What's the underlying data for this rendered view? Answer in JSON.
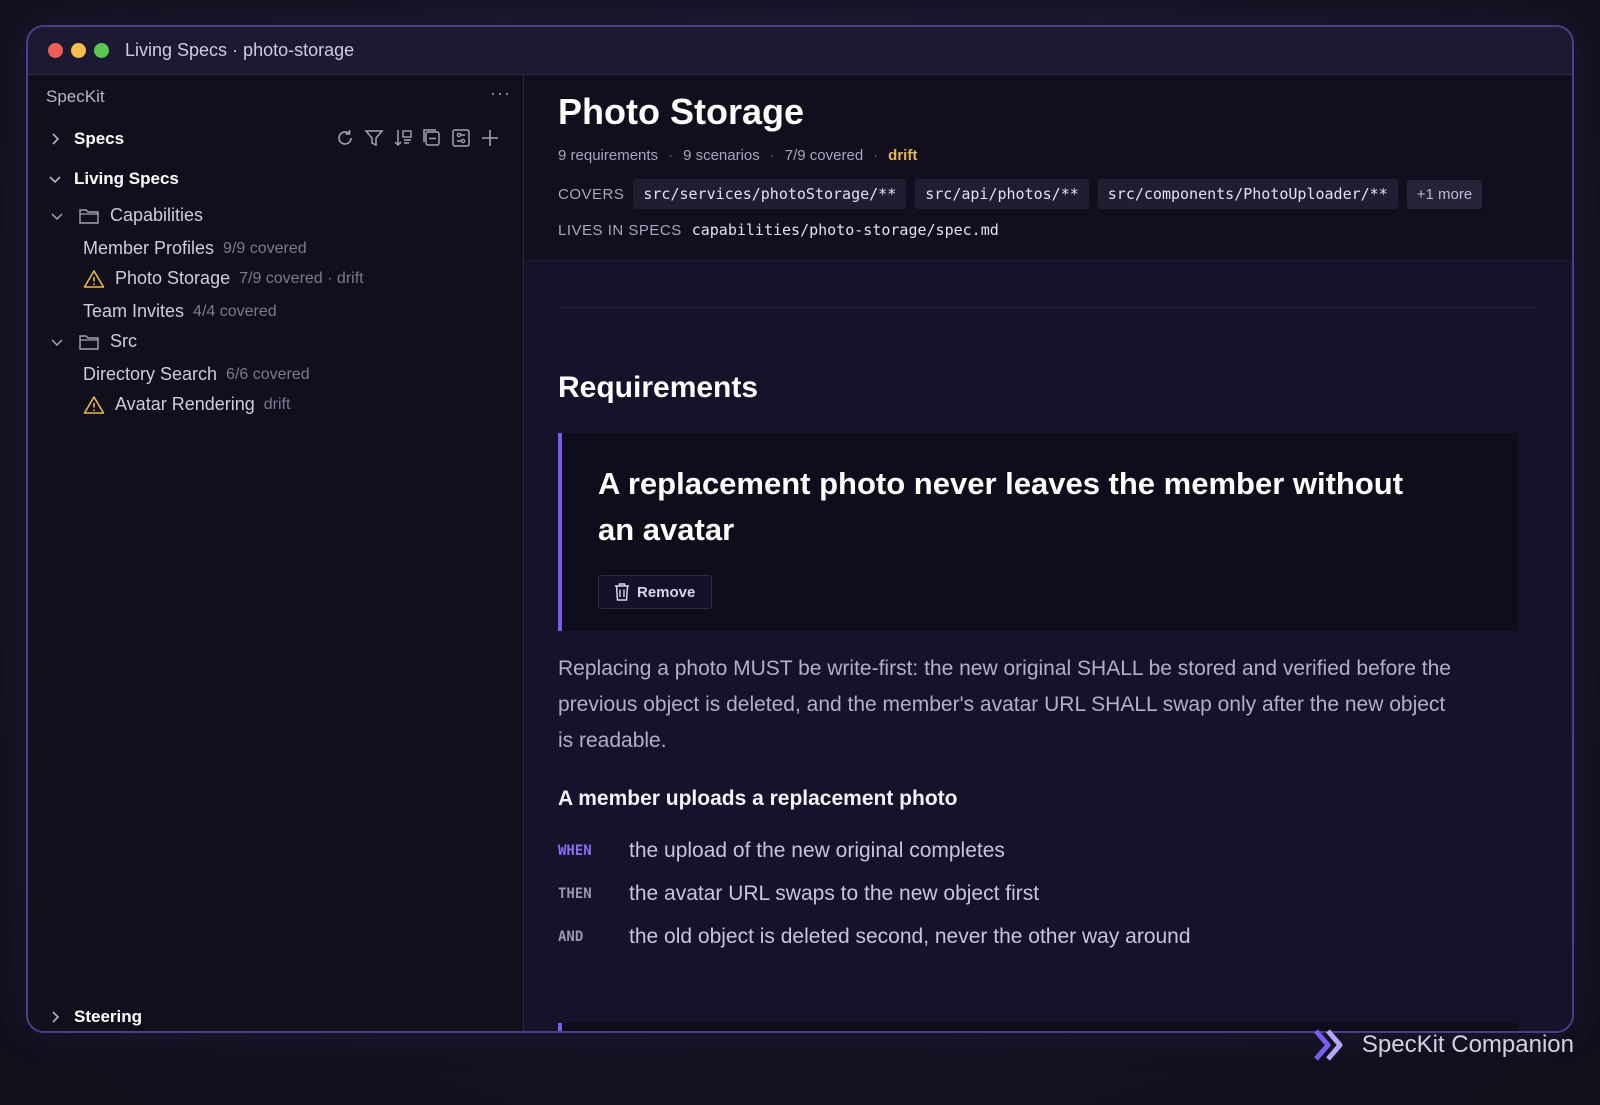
{
  "window": {
    "title": "Living Specs · photo-storage"
  },
  "sidebar": {
    "header": "SpecKit",
    "more": "···",
    "specs_label": "Specs",
    "living_specs_label": "Living Specs",
    "toolbar_icons": [
      "refresh-icon",
      "filter-icon",
      "sort-icon",
      "collapse-icon",
      "settings-icon",
      "plus-icon"
    ],
    "folders": [
      {
        "label": "Capabilities",
        "items": [
          {
            "label": "Member Profiles",
            "meta": "9/9 covered",
            "warning": false
          },
          {
            "label": "Photo Storage",
            "meta": "7/9 covered · drift",
            "warning": true
          },
          {
            "label": "Team Invites",
            "meta": "4/4 covered",
            "warning": false
          }
        ]
      },
      {
        "label": "Src",
        "items": [
          {
            "label": "Directory Search",
            "meta": "6/6 covered",
            "warning": false
          },
          {
            "label": "Avatar Rendering",
            "meta": "drift",
            "warning": true
          }
        ]
      }
    ],
    "steering_label": "Steering"
  },
  "main": {
    "title": "Photo Storage",
    "stats": {
      "requirements": "9 requirements",
      "scenarios": "9 scenarios",
      "covered": "7/9 covered",
      "status": "drift"
    },
    "covers_label": "COVERS",
    "covers": [
      "src/services/photoStorage/**",
      "src/api/photos/**",
      "src/components/PhotoUploader/**"
    ],
    "covers_more": "+1 more",
    "lives_label": "LIVES IN SPECS",
    "lives_path": "capabilities/photo-storage/spec.md",
    "section_title": "Requirements",
    "requirement": {
      "title": "A replacement photo never leaves the member without an avatar",
      "remove_label": "Remove",
      "body": "Replacing a photo MUST be write-first: the new original SHALL be stored and verified before the previous object is deleted, and the member's avatar URL SHALL swap only after the new object is readable.",
      "scenario_title": "A member uploads a replacement photo",
      "steps": [
        {
          "keyword": "WHEN",
          "text": "the upload of the new original completes"
        },
        {
          "keyword": "THEN",
          "text": "the avatar URL swaps to the new object first"
        },
        {
          "keyword": "AND",
          "text": "the old object is deleted second, never the other way around"
        }
      ]
    }
  },
  "brand": {
    "name": "SpecKit Companion"
  },
  "colors": {
    "accent": "#7c5cf0",
    "warning": "#e6b84d",
    "background": "#15132a"
  }
}
